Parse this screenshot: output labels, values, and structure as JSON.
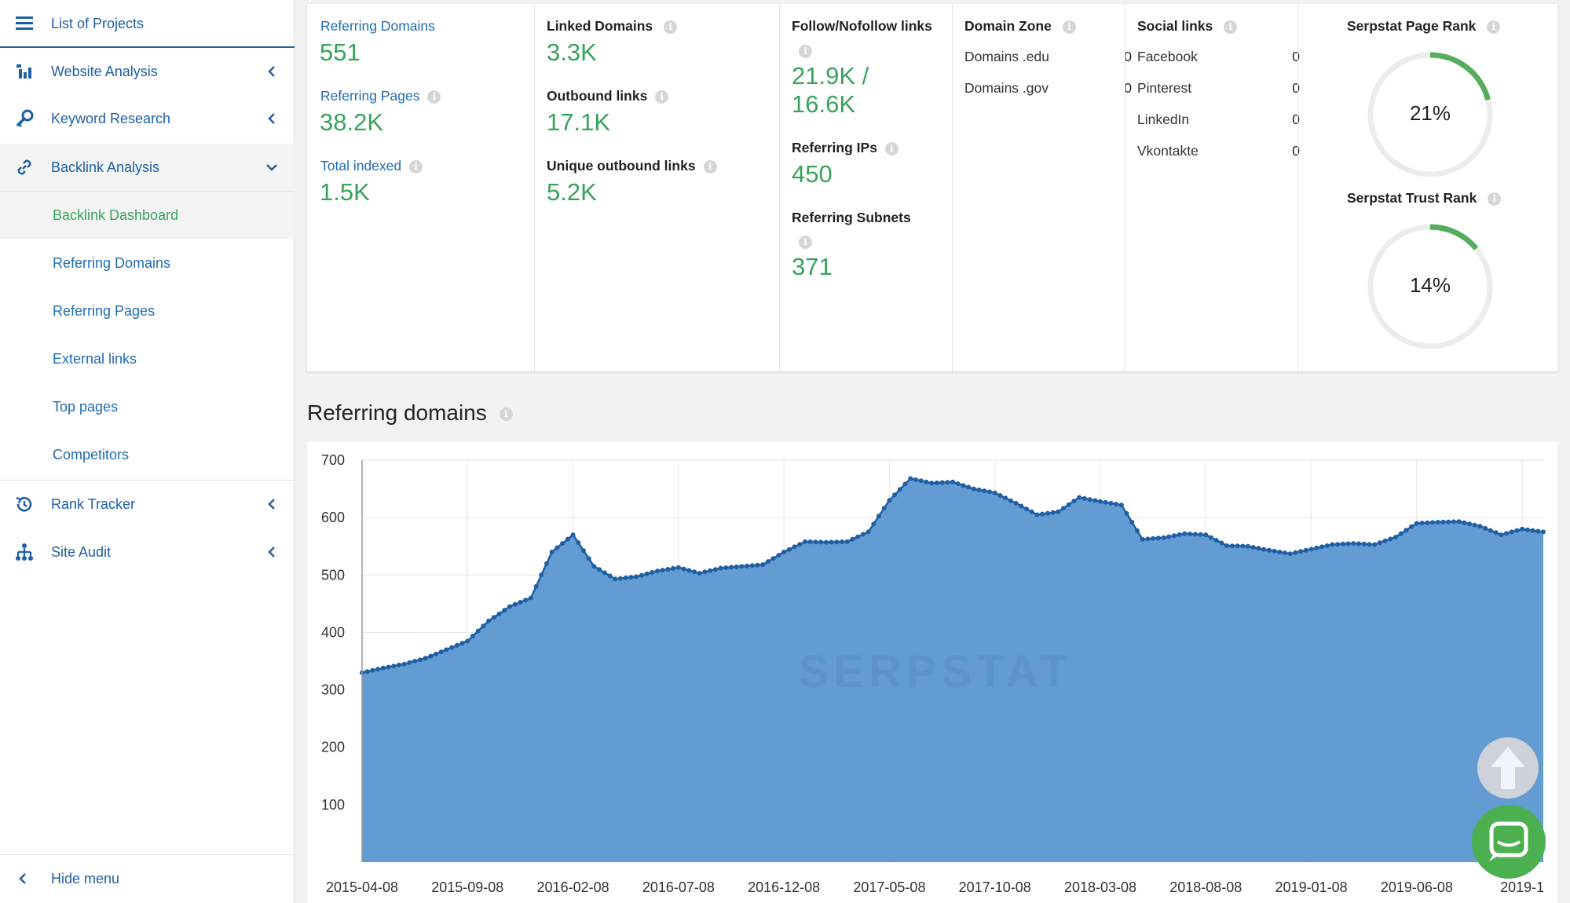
{
  "sidebar": {
    "header": {
      "label": "List of Projects",
      "icon": "menu-icon"
    },
    "items": [
      {
        "label": "Website Analysis",
        "icon": "chart-bars-icon",
        "expanded": false
      },
      {
        "label": "Keyword Research",
        "icon": "key-icon",
        "expanded": false
      },
      {
        "label": "Backlink Analysis",
        "icon": "link-icon",
        "expanded": true
      }
    ],
    "subitems": [
      {
        "label": "Backlink Dashboard",
        "active": true
      },
      {
        "label": "Referring Domains",
        "active": false
      },
      {
        "label": "Referring Pages",
        "active": false
      },
      {
        "label": "External links",
        "active": false
      },
      {
        "label": "Top pages",
        "active": false
      },
      {
        "label": "Competitors",
        "active": false
      }
    ],
    "items_after": [
      {
        "label": "Rank Tracker",
        "icon": "history-icon",
        "expanded": false
      },
      {
        "label": "Site Audit",
        "icon": "sitemap-icon",
        "expanded": false
      }
    ],
    "hide_menu": "Hide menu"
  },
  "stats": {
    "referring_domains": {
      "label": "Referring Domains",
      "value": "551"
    },
    "referring_pages": {
      "label": "Referring Pages",
      "value": "38.2K"
    },
    "total_indexed": {
      "label": "Total indexed",
      "value": "1.5K"
    },
    "linked_domains": {
      "label": "Linked Domains",
      "value": "3.3K"
    },
    "outbound_links": {
      "label": "Outbound links",
      "value": "17.1K"
    },
    "unique_outbound": {
      "label": "Unique outbound links",
      "value": "5.2K"
    },
    "follow_nofollow": {
      "label": "Follow/Nofollow links",
      "value_line1": "21.9K  /",
      "value_line2": "16.6K"
    },
    "referring_ips": {
      "label": "Referring IPs",
      "value": "450"
    },
    "referring_subnets": {
      "label": "Referring Subnets",
      "value": "371"
    },
    "domain_zone": {
      "label": "Domain Zone",
      "rows": [
        {
          "name": "Domains .edu",
          "value": "0"
        },
        {
          "name": "Domains .gov",
          "value": "0"
        }
      ]
    },
    "social_links": {
      "label": "Social links",
      "rows": [
        {
          "name": "Facebook",
          "value": "0"
        },
        {
          "name": "Pinterest",
          "value": "0"
        },
        {
          "name": "LinkedIn",
          "value": "0"
        },
        {
          "name": "Vkontakte",
          "value": "0"
        }
      ]
    },
    "page_rank": {
      "label": "Serpstat Page Rank",
      "value": "21%",
      "fraction": 0.21
    },
    "trust_rank": {
      "label": "Serpstat Trust Rank",
      "value": "14%",
      "fraction": 0.14
    }
  },
  "colors": {
    "green": "#39a35c",
    "blue_link": "#1f6bb0",
    "area_fill": "#5b97d0",
    "area_line": "#1f5fa5"
  },
  "section_title": "Referring domains",
  "chart_data": {
    "type": "area",
    "xlabel": "",
    "ylabel": "",
    "ylim": [
      0,
      700
    ],
    "yticks": [
      100,
      200,
      300,
      400,
      500,
      600,
      700
    ],
    "xtick_labels": [
      "2015-04-08",
      "2015-09-08",
      "2016-02-08",
      "2016-07-08",
      "2016-12-08",
      "2017-05-08",
      "2017-10-08",
      "2018-03-08",
      "2018-08-08",
      "2019-01-08",
      "2019-06-08",
      "2019-1"
    ],
    "watermark": "SERPSTAT",
    "series": [
      {
        "points": [
          [
            "2015-04-08",
            330
          ],
          [
            "2015-05-08",
            338
          ],
          [
            "2015-06-08",
            345
          ],
          [
            "2015-07-08",
            355
          ],
          [
            "2015-08-08",
            370
          ],
          [
            "2015-09-08",
            385
          ],
          [
            "2015-10-08",
            420
          ],
          [
            "2015-11-08",
            445
          ],
          [
            "2015-12-08",
            460
          ],
          [
            "2016-01-08",
            540
          ],
          [
            "2016-02-08",
            570
          ],
          [
            "2016-03-08",
            515
          ],
          [
            "2016-04-08",
            493
          ],
          [
            "2016-05-08",
            497
          ],
          [
            "2016-06-08",
            507
          ],
          [
            "2016-07-08",
            513
          ],
          [
            "2016-08-08",
            503
          ],
          [
            "2016-09-08",
            512
          ],
          [
            "2016-10-08",
            515
          ],
          [
            "2016-11-08",
            518
          ],
          [
            "2016-12-08",
            540
          ],
          [
            "2017-01-08",
            558
          ],
          [
            "2017-02-08",
            557
          ],
          [
            "2017-03-08",
            558
          ],
          [
            "2017-04-08",
            575
          ],
          [
            "2017-05-08",
            630
          ],
          [
            "2017-06-08",
            668
          ],
          [
            "2017-07-08",
            660
          ],
          [
            "2017-08-08",
            662
          ],
          [
            "2017-09-08",
            650
          ],
          [
            "2017-10-08",
            643
          ],
          [
            "2017-11-08",
            625
          ],
          [
            "2017-12-08",
            605
          ],
          [
            "2018-01-08",
            610
          ],
          [
            "2018-02-08",
            635
          ],
          [
            "2018-03-08",
            628
          ],
          [
            "2018-04-08",
            622
          ],
          [
            "2018-05-08",
            562
          ],
          [
            "2018-06-08",
            565
          ],
          [
            "2018-07-08",
            572
          ],
          [
            "2018-08-08",
            570
          ],
          [
            "2018-09-08",
            551
          ],
          [
            "2018-10-08",
            550
          ],
          [
            "2018-11-08",
            543
          ],
          [
            "2018-12-08",
            537
          ],
          [
            "2019-01-08",
            545
          ],
          [
            "2019-02-08",
            553
          ],
          [
            "2019-03-08",
            555
          ],
          [
            "2019-04-08",
            553
          ],
          [
            "2019-05-08",
            566
          ],
          [
            "2019-06-08",
            590
          ],
          [
            "2019-07-08",
            592
          ],
          [
            "2019-08-08",
            593
          ],
          [
            "2019-09-08",
            585
          ],
          [
            "2019-10-08",
            570
          ],
          [
            "2019-11-08",
            580
          ],
          [
            "2019-12-08",
            575
          ]
        ]
      }
    ]
  }
}
